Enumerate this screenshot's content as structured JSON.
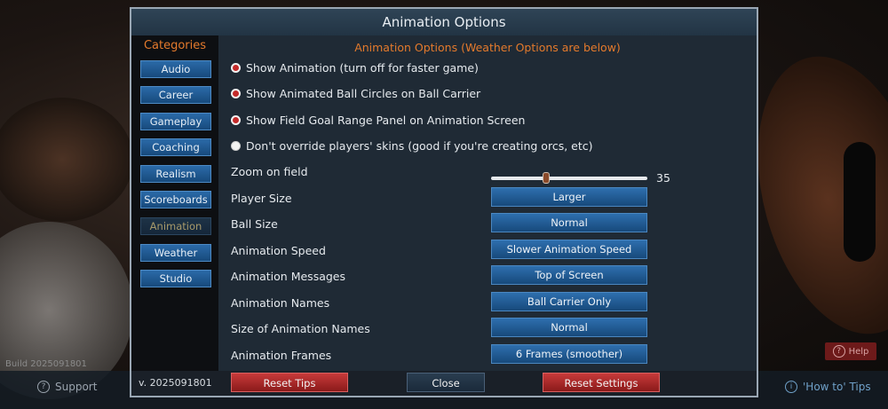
{
  "background": {
    "build_text": "Build 2025091801",
    "support_label": "Support",
    "howto_label": "'How to' Tips",
    "help_label": "Help"
  },
  "dialog": {
    "title": "Animation Options",
    "categories_title": "Categories",
    "categories": [
      {
        "label": "Audio",
        "active": false
      },
      {
        "label": "Career",
        "active": false
      },
      {
        "label": "Gameplay",
        "active": false
      },
      {
        "label": "Coaching",
        "active": false
      },
      {
        "label": "Realism",
        "active": false
      },
      {
        "label": "Scoreboards",
        "active": false
      },
      {
        "label": "Animation",
        "active": true
      },
      {
        "label": "Weather",
        "active": false
      },
      {
        "label": "Studio",
        "active": false
      }
    ],
    "section_title": "Animation Options (Weather Options are below)",
    "checkboxes": [
      {
        "label": "Show Animation (turn off for faster game)",
        "checked": true
      },
      {
        "label": "Show Animated Ball Circles on Ball Carrier",
        "checked": true
      },
      {
        "label": "Show Field Goal Range Panel on Animation Screen",
        "checked": true
      },
      {
        "label": "Don't override players' skins (good if you're creating orcs, etc)",
        "checked": false
      }
    ],
    "zoom": {
      "label": "Zoom on field",
      "value": "35",
      "fraction": 0.35
    },
    "settings": [
      {
        "label": "Player Size",
        "value": "Larger"
      },
      {
        "label": "Ball Size",
        "value": "Normal"
      },
      {
        "label": "Animation Speed",
        "value": "Slower Animation Speed"
      },
      {
        "label": "Animation Messages",
        "value": "Top of Screen"
      },
      {
        "label": "Animation Names",
        "value": "Ball Carrier Only"
      },
      {
        "label": "Size of Animation Names",
        "value": "Normal"
      },
      {
        "label": "Animation Frames",
        "value": "6 Frames (smoother)"
      }
    ],
    "footer": {
      "version": "v. 2025091801",
      "reset_tips": "Reset Tips",
      "close": "Close",
      "reset_settings": "Reset Settings"
    },
    "colors": {
      "accent_orange": "#e47a2c",
      "button_blue": "#2e6fae",
      "button_red": "#c83a3a"
    }
  }
}
